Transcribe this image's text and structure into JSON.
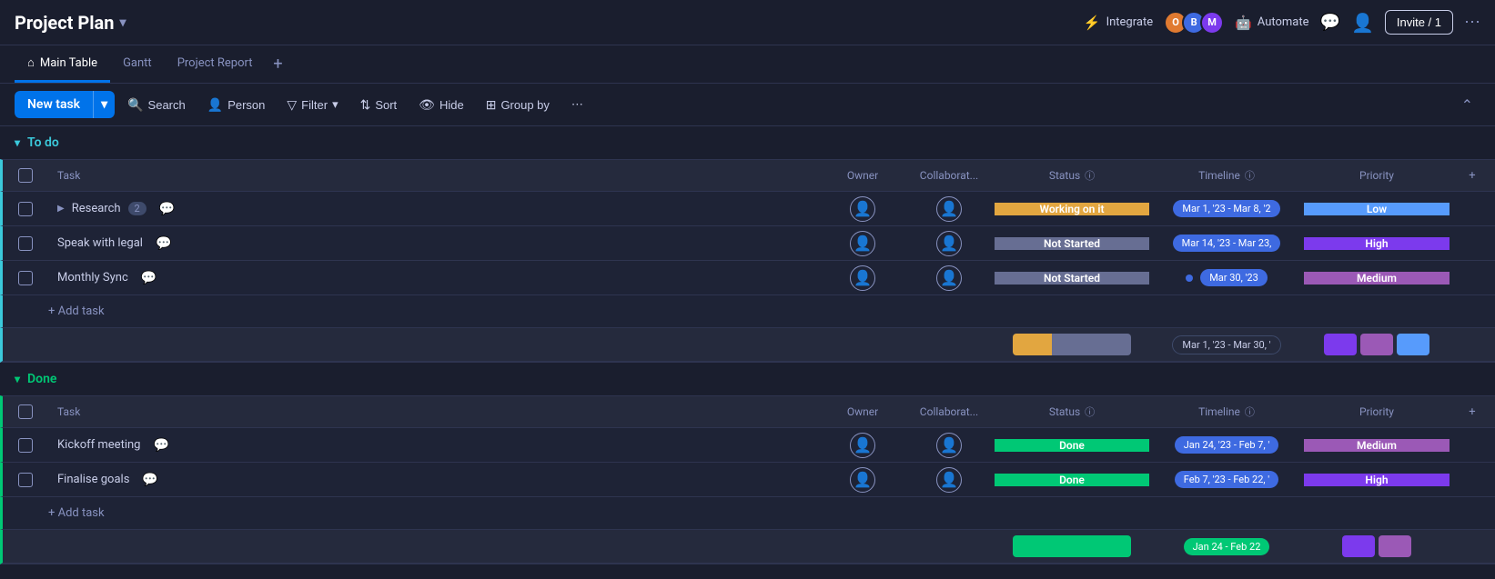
{
  "header": {
    "title": "Project Plan",
    "chevron": "▾",
    "integrate_label": "Integrate",
    "automate_label": "Automate",
    "invite_label": "Invite / 1",
    "more_icon": "⋯"
  },
  "tabs": [
    {
      "id": "main-table",
      "label": "Main Table",
      "icon": "⌂",
      "active": true
    },
    {
      "id": "gantt",
      "label": "Gantt",
      "icon": "",
      "active": false
    },
    {
      "id": "project-report",
      "label": "Project Report",
      "icon": "",
      "active": false
    }
  ],
  "toolbar": {
    "new_task_label": "New task",
    "search_label": "Search",
    "person_label": "Person",
    "filter_label": "Filter",
    "sort_label": "Sort",
    "hide_label": "Hide",
    "group_by_label": "Group by",
    "more_icon": "⋯"
  },
  "todo_section": {
    "title": "To do",
    "collapse_icon": "▾",
    "columns": {
      "task": "Task",
      "owner": "Owner",
      "collaborator": "Collaborat...",
      "status": "Status",
      "timeline": "Timeline",
      "priority": "Priority"
    },
    "rows": [
      {
        "id": "research",
        "name": "Research",
        "badge": "2",
        "has_expand": true,
        "owner": "",
        "collaborator": "",
        "status": "Working on it",
        "status_class": "status-working",
        "timeline": "Mar 1, '23 - Mar 8, '2",
        "priority": "Low",
        "priority_class": "priority-low"
      },
      {
        "id": "speak-with-legal",
        "name": "Speak with legal",
        "badge": "",
        "has_expand": false,
        "owner": "",
        "collaborator": "",
        "status": "Not Started",
        "status_class": "status-not-started",
        "timeline": "Mar 14, '23 - Mar 23,",
        "priority": "High",
        "priority_class": "priority-high"
      },
      {
        "id": "monthly-sync",
        "name": "Monthly Sync",
        "badge": "",
        "has_expand": false,
        "owner": "",
        "collaborator": "",
        "status": "Not Started",
        "status_class": "status-not-started",
        "timeline": "Mar 30, '23",
        "priority": "Medium",
        "priority_class": "priority-medium"
      }
    ],
    "add_task_label": "+ Add task",
    "summary_timeline": "Mar 1, '23 - Mar 30, '"
  },
  "done_section": {
    "title": "Done",
    "collapse_icon": "▾",
    "columns": {
      "task": "Task",
      "owner": "Owner",
      "collaborator": "Collaborat...",
      "status": "Status",
      "timeline": "Timeline",
      "priority": "Priority"
    },
    "rows": [
      {
        "id": "kickoff-meeting",
        "name": "Kickoff meeting",
        "badge": "",
        "has_expand": false,
        "owner": "",
        "collaborator": "",
        "status": "Done",
        "status_class": "status-done",
        "timeline": "Jan 24, '23 - Feb 7, '",
        "priority": "Medium",
        "priority_class": "priority-medium"
      },
      {
        "id": "finalise-goals",
        "name": "Finalise goals",
        "badge": "",
        "has_expand": false,
        "owner": "",
        "collaborator": "",
        "status": "Done",
        "status_class": "status-done",
        "timeline": "Feb 7, '23 - Feb 22, '",
        "priority": "High",
        "priority_class": "priority-high"
      }
    ],
    "add_task_label": "+ Add task"
  }
}
